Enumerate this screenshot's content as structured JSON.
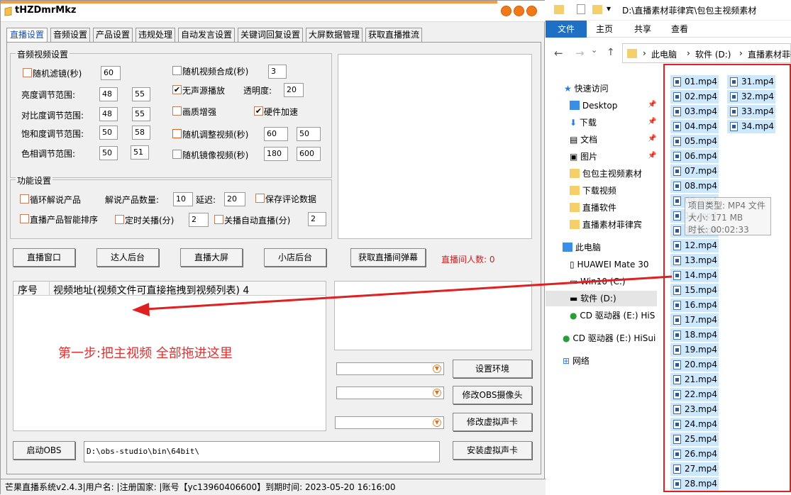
{
  "app": {
    "title": "tHZDmrMkz"
  },
  "tabs": [
    "直播设置",
    "音频设置",
    "产品设置",
    "违规处理",
    "自动发言设置",
    "关键词回复设置",
    "大屏数据管理",
    "获取直播推流"
  ],
  "av": {
    "legend": "音频视频设置",
    "random_filter": "随机滤镜(秒)",
    "random_filter_val": "60",
    "random_synth": "随机视频合成(秒)",
    "random_synth_val": "3",
    "brightness": "亮度调节范围:",
    "brightness_min": "48",
    "brightness_max": "55",
    "no_source": "无声源播放",
    "opacity": "透明度:",
    "opacity_val": "20",
    "contrast": "对比度调节范围:",
    "contrast_min": "48",
    "contrast_max": "55",
    "quality": "画质增强",
    "hw_accel": "硬件加速",
    "saturation": "饱和度调节范围:",
    "saturation_min": "50",
    "saturation_max": "58",
    "random_adjust": "随机调整视频(秒)",
    "random_adjust_a": "60",
    "random_adjust_b": "50",
    "hue": "色相调节范围:",
    "hue_min": "50",
    "hue_max": "51",
    "random_mirror": "随机镜像视频(秒)",
    "random_mirror_a": "180",
    "random_mirror_b": "600"
  },
  "func": {
    "legend": "功能设置",
    "loop_explain": "循环解说产品",
    "explain_count": "解说产品数量:",
    "explain_count_val": "10",
    "delay": "延迟:",
    "delay_val": "20",
    "save_comments": "保存评论数据",
    "smart_sort": "直播产品智能排序",
    "timer_close": "定时关播(分)",
    "timer_close_val": "2",
    "auto_restart": "关播自动直播(分)",
    "auto_restart_val": "2"
  },
  "buttons": {
    "live_window": "直播窗口",
    "talent_backend": "达人后台",
    "big_screen": "直播大屏",
    "shop_backend": "小店后台",
    "get_danmaku": "获取直播间弹幕",
    "viewers": "直播间人数: 0",
    "set_env": "设置环境",
    "modify_obs_cam": "修改OBS摄像头",
    "modify_virtual_audio": "修改虚拟声卡",
    "start_obs": "启动OBS",
    "install_virtual_audio": "安装虚拟声卡"
  },
  "table": {
    "col_no": "序号",
    "col_addr": "视频地址(视频文件可直接拖拽到视频列表) 4"
  },
  "annotation": "第一步:把主视频 全部拖进这里",
  "obs_path": "D:\\obs-studio\\bin\\64bit\\",
  "status": "芒果直播系统v2.4.3|用户名: |注册国家: |账号【yc13960406600】到期时间: 2023-05-20 16:16:00",
  "explorer": {
    "path": "D:\\直播素材菲律宾\\包包主视频素材",
    "ribbon": [
      "文件",
      "主页",
      "共享",
      "查看"
    ],
    "breadcrumb": [
      "此电脑",
      "软件 (D:)",
      "直播素材菲律"
    ],
    "nav": {
      "quick": "快速访问",
      "desktop": "Desktop",
      "downloads": "下载",
      "docs": "文档",
      "pics": "图片",
      "f1": "包包主视频素材",
      "f2": "下载视频",
      "f3": "直播软件",
      "f4": "直播素材菲律宾",
      "pc": "此电脑",
      "phone": "HUAWEI Mate 30",
      "c": "Win10 (C:)",
      "d": "软件 (D:)",
      "cd1": "CD 驱动器 (E:) HiS",
      "cd2": "CD 驱动器 (E:) HiSui",
      "net": "网络"
    },
    "files_col1": [
      "01.mp4",
      "02.mp4",
      "03.mp4",
      "04.mp4",
      "05.mp4",
      "06.mp4",
      "07.mp4",
      "08.mp4",
      "09.mp4",
      "10.mp4",
      "11.mp4",
      "12.mp4",
      "13.mp4",
      "14.mp4",
      "15.mp4",
      "16.mp4",
      "17.mp4",
      "18.mp4",
      "19.mp4",
      "20.mp4",
      "21.mp4",
      "22.mp4",
      "23.mp4",
      "24.mp4",
      "25.mp4",
      "26.mp4",
      "27.mp4",
      "28.mp4"
    ],
    "files_col2": [
      "31.mp4",
      "32.mp4",
      "33.mp4",
      "34.mp4"
    ],
    "tooltip": {
      "type": "项目类型: MP4 文件",
      "size": "大小: 171 MB",
      "duration": "时长: 00:02:33"
    }
  },
  "colors": {
    "accent": "#f07a1a",
    "arrow": "#e02020",
    "annotation": "#e03030",
    "selection": "#cce8ff",
    "ribbon_file": "#1f6fc4"
  }
}
